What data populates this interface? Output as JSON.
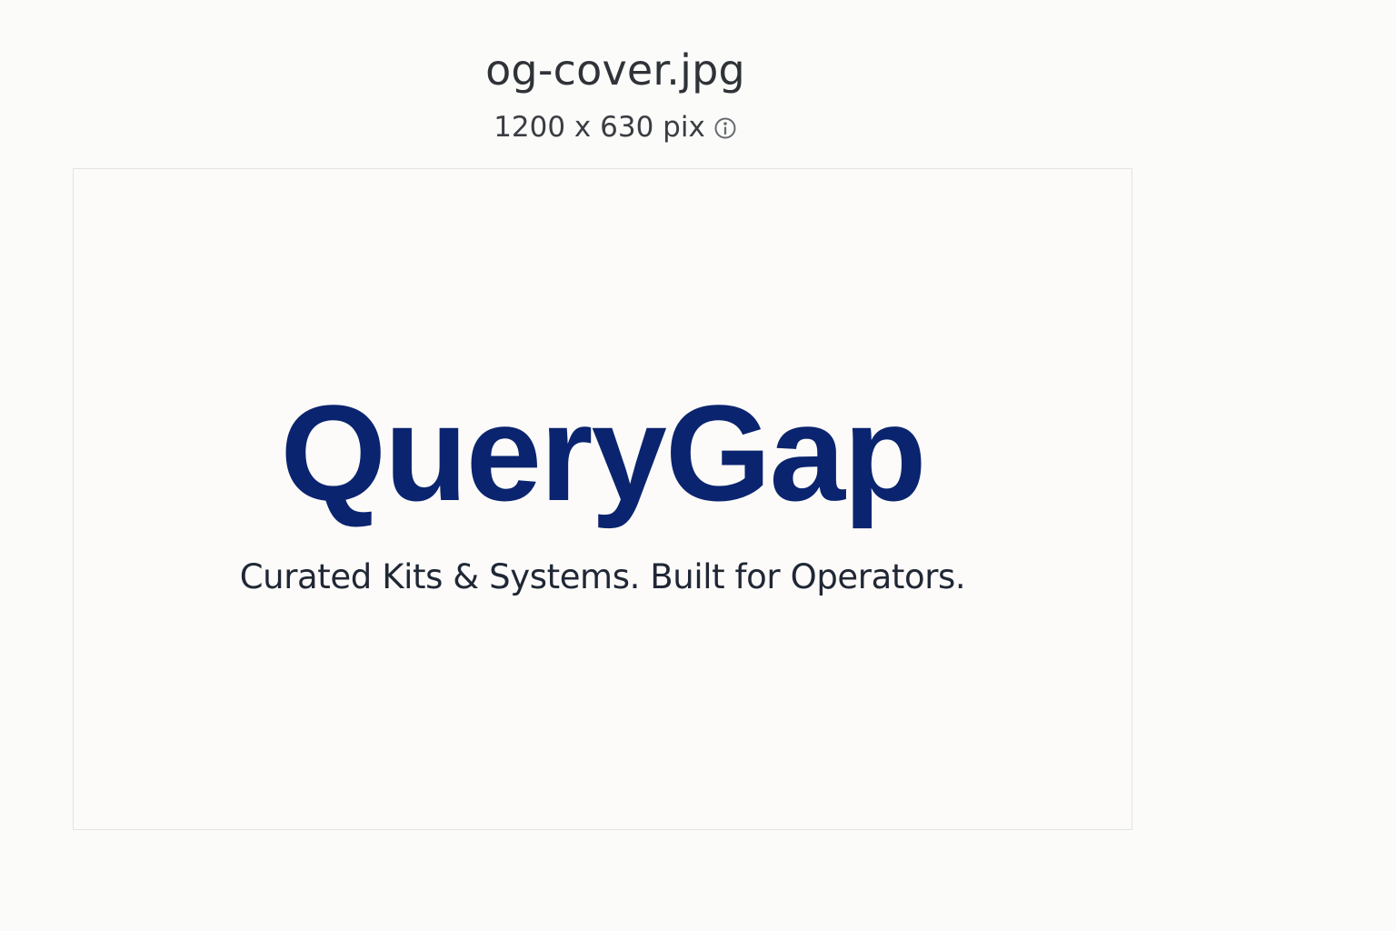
{
  "file": {
    "name": "og-cover.jpg",
    "dimensions": "1200 x 630 pix",
    "info_icon": "info-circle-icon"
  },
  "preview": {
    "title": "QueryGap",
    "tagline": "Curated Kits & Systems. Built for Operators.",
    "title_color": "#0b246f",
    "tagline_color": "#202735",
    "background_color": "#fcfbf9"
  }
}
